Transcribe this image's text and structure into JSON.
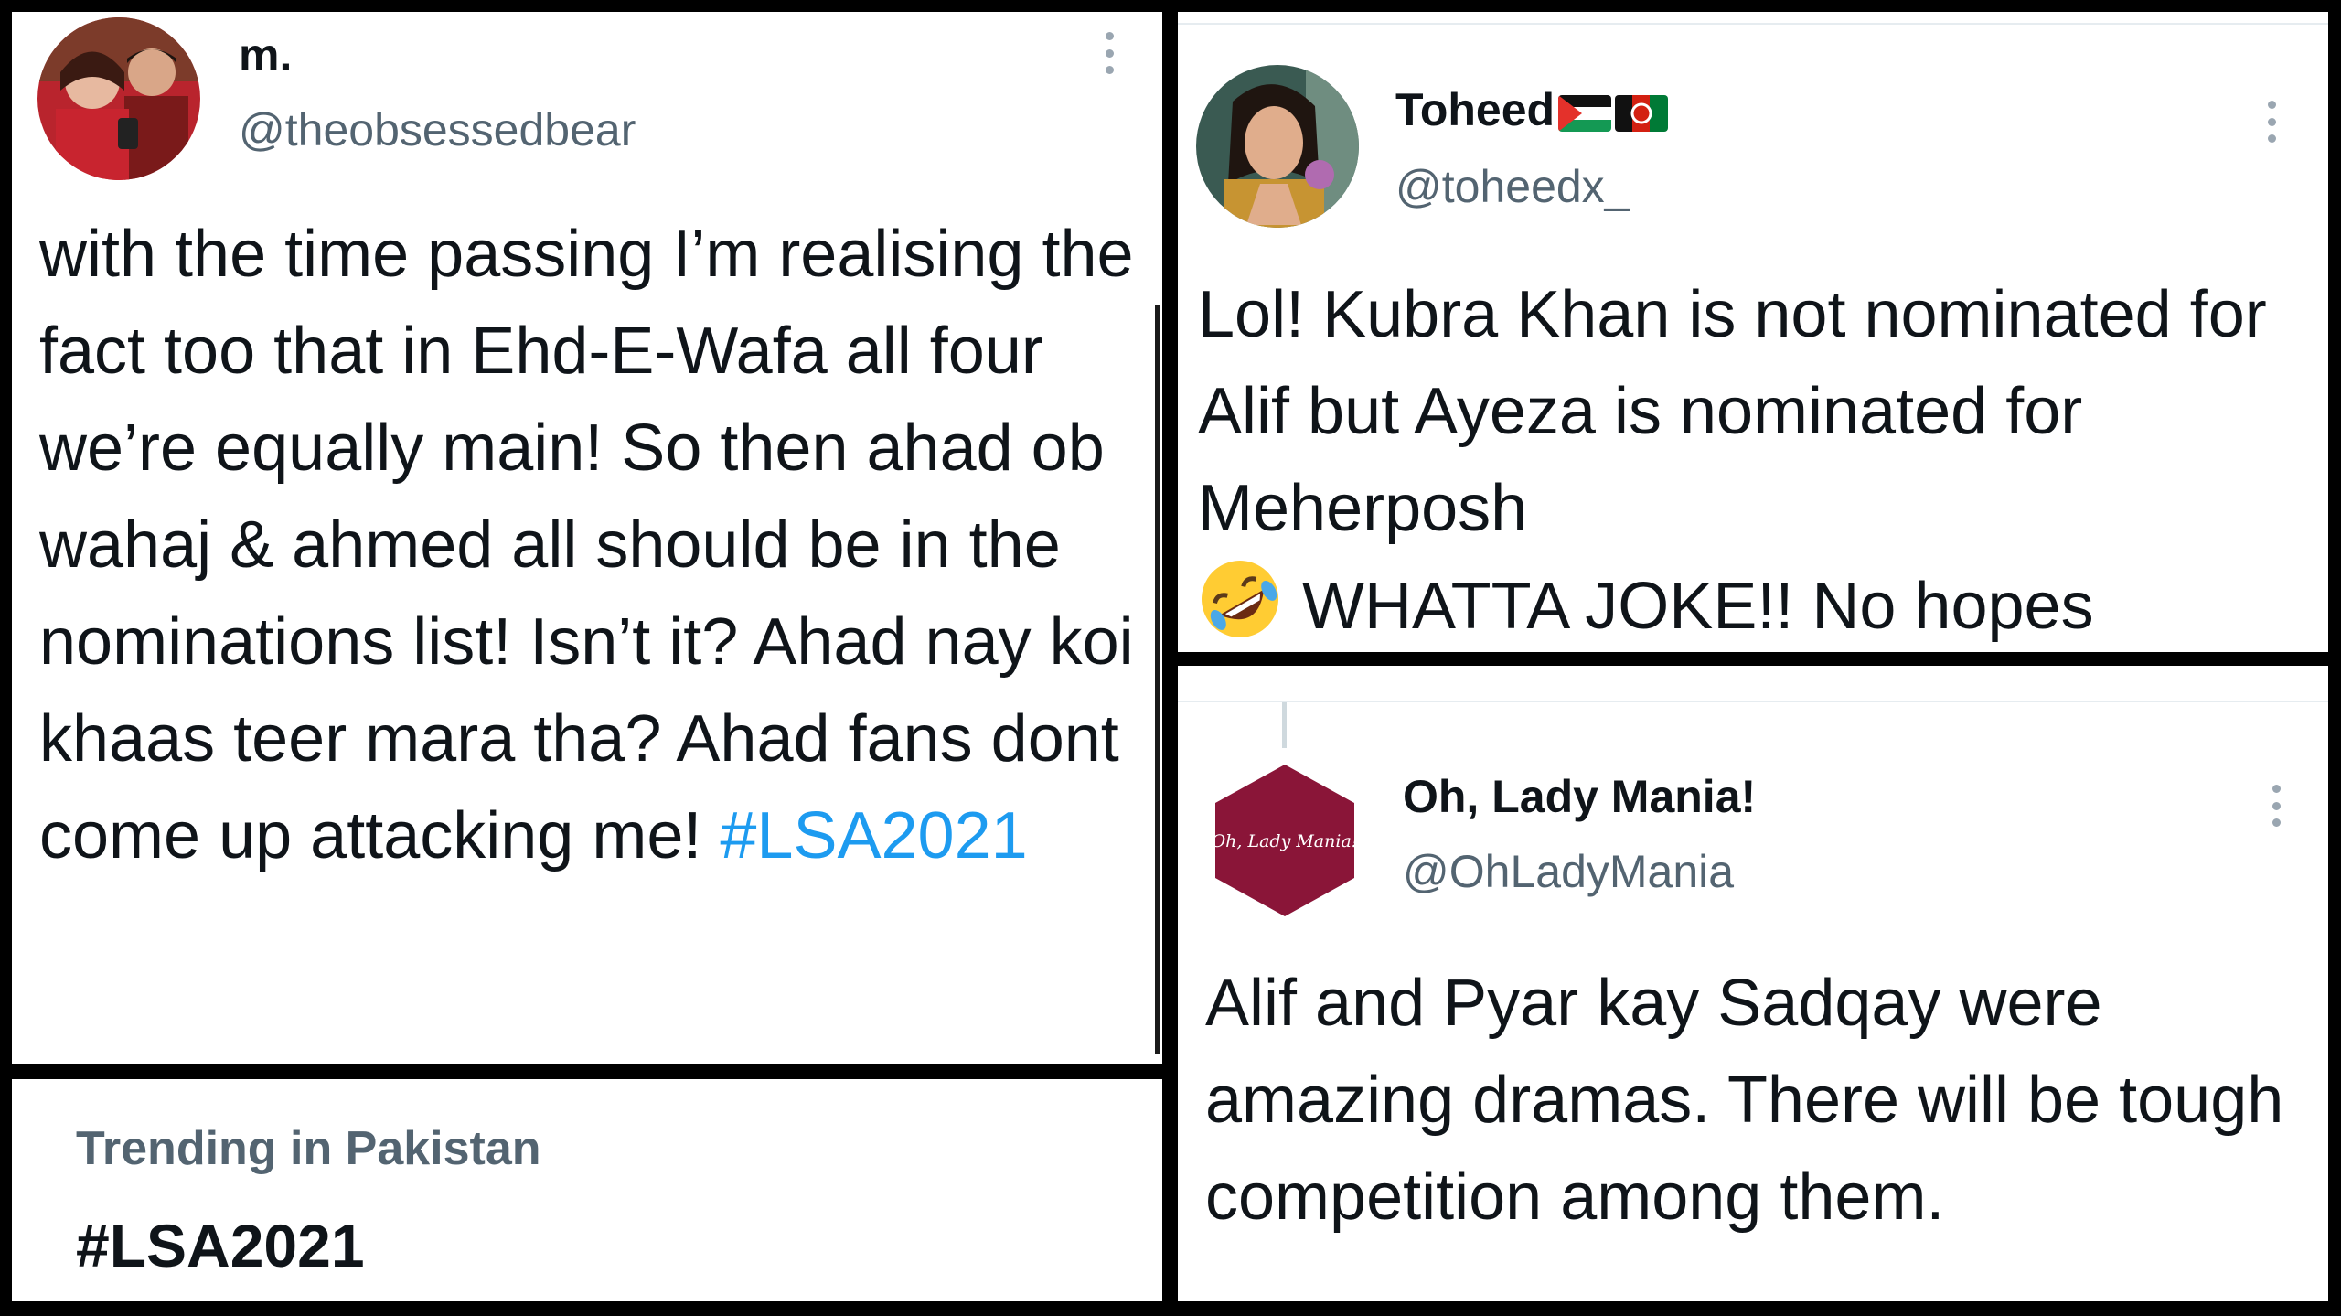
{
  "tweets": [
    {
      "name": "m.",
      "handle": "@theobsessedbear",
      "text": "with the time passing I’m realising the fact too that in Ehd-E-Wafa all four we’re equally main! So then ahad ob wahaj & ahmed all should be in the nominations list! Isn’t it? Ahad nay koi khaas teer mara tha? Ahad fans dont come up attacking me!",
      "hashtag": "#LSA2021",
      "avatar": "couple-photo"
    },
    {
      "name": "Toheed",
      "handle": "@toheedx_",
      "text": "Lol! Kubra Khan is not nominated for Alif but Ayeza is nominated for Meherposh",
      "text2": "WHATTA JOKE!! No hopes",
      "emoji": "rolling-on-floor-laughing-emoji",
      "flags": [
        "palestine-flag",
        "afghanistan-flag"
      ],
      "avatar": "woman-photo"
    },
    {
      "name": "Oh, Lady Mania!",
      "handle": "@OhLadyMania",
      "text": "Alif and Pyar kay Sadqay were amazing dramas. There will be tough competition among them.",
      "logo_text": "Oh, Lady Mania!",
      "avatar": "hexagon-logo"
    }
  ],
  "trending": {
    "label": "Trending in Pakistan",
    "tag": "#LSA2021"
  },
  "colors": {
    "hashtag": "#1d9bf0",
    "secondary_text": "#536471",
    "logo_bg": "#8a1538"
  }
}
